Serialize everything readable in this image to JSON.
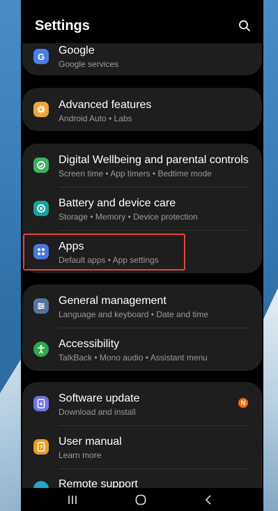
{
  "header": {
    "title": "Settings"
  },
  "colors": {
    "google": "#4c7fe6",
    "advanced": "#f0a53a",
    "wellbeing": "#3db35f",
    "battery": "#15a3a0",
    "apps": "#4a76e0",
    "general": "#55769f",
    "accessibility": "#2ea84c",
    "software": "#6f76e6",
    "manual": "#e8a020",
    "remote": "#20a6cf",
    "highlight": "#e8433a",
    "badge": "#ff6a00"
  },
  "items": {
    "google": {
      "label": "Google",
      "sub": "Google services",
      "icon": "google-icon"
    },
    "advanced": {
      "label": "Advanced features",
      "sub": "Android Auto  •  Labs",
      "icon": "advanced-features-icon"
    },
    "wellbeing": {
      "label": "Digital Wellbeing and parental controls",
      "sub": "Screen time  •  App timers  •  Bedtime mode",
      "icon": "wellbeing-icon"
    },
    "battery": {
      "label": "Battery and device care",
      "sub": "Storage  •  Memory  •  Device protection",
      "icon": "battery-care-icon"
    },
    "apps": {
      "label": "Apps",
      "sub": "Default apps  •  App settings",
      "icon": "apps-icon"
    },
    "general": {
      "label": "General management",
      "sub": "Language and keyboard  •  Date and time",
      "icon": "general-management-icon"
    },
    "accessibility": {
      "label": "Accessibility",
      "sub": "TalkBack  •  Mono audio  •  Assistant menu",
      "icon": "accessibility-icon"
    },
    "software": {
      "label": "Software update",
      "sub": "Download and install",
      "icon": "software-update-icon",
      "badge": "N"
    },
    "manual": {
      "label": "User manual",
      "sub": "Learn more",
      "icon": "user-manual-icon"
    },
    "remote": {
      "label": "Remote support",
      "icon": "remote-support-icon"
    }
  },
  "navbar": {
    "recents": "recents-icon",
    "home": "home-icon",
    "back": "back-icon"
  }
}
